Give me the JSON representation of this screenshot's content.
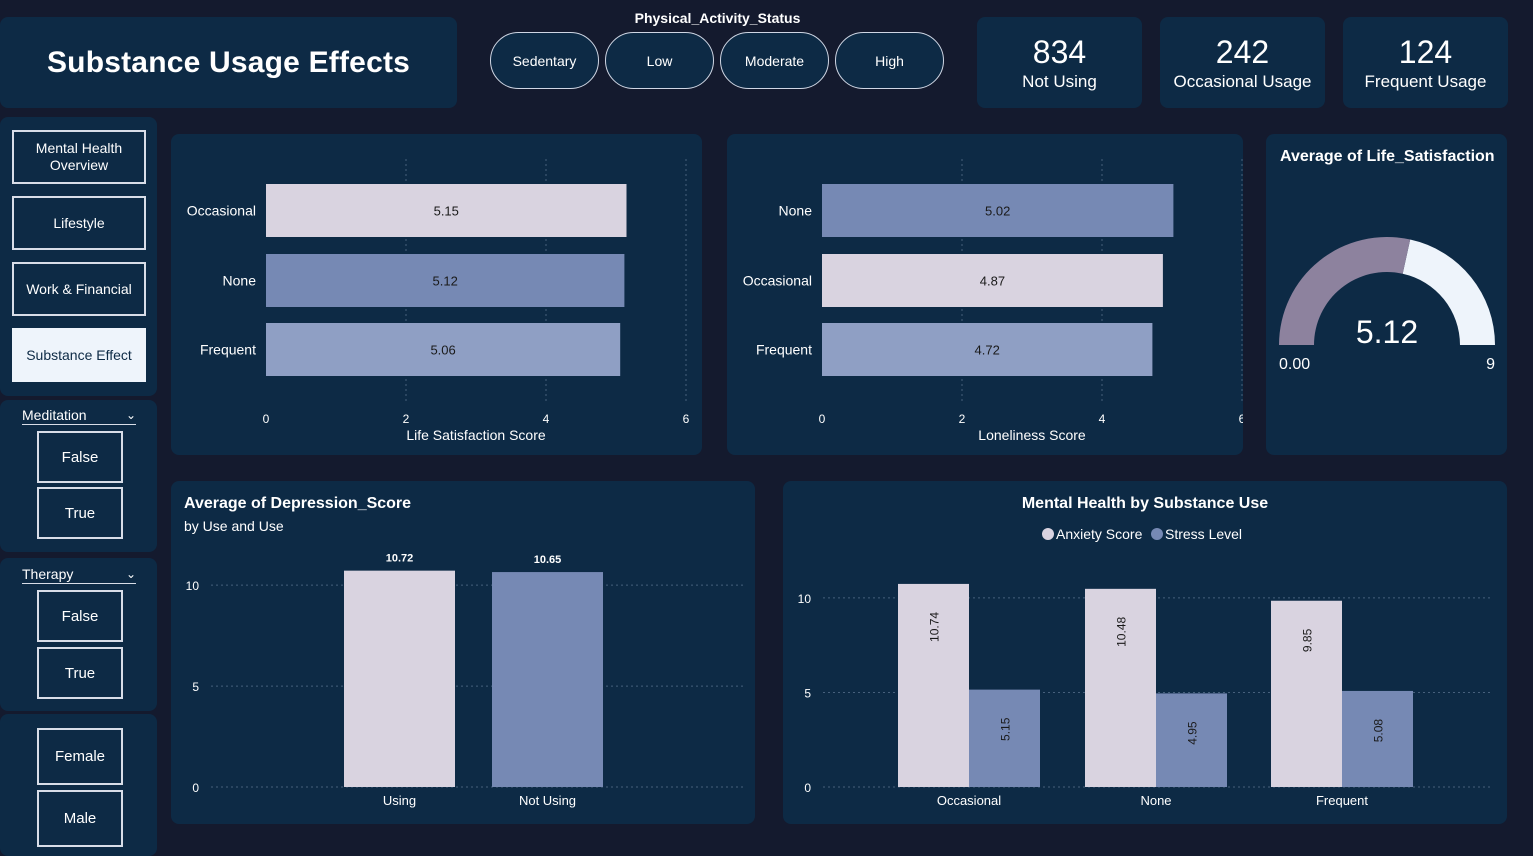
{
  "header": {
    "title": "Substance Usage Effects"
  },
  "physical_activity": {
    "label": "Physical_Activity_Status",
    "options": [
      "Sedentary",
      "Low",
      "Moderate",
      "High"
    ]
  },
  "kpis": [
    {
      "value": "834",
      "label": "Not Using"
    },
    {
      "value": "242",
      "label": "Occasional Usage"
    },
    {
      "value": "124",
      "label": "Frequent Usage"
    }
  ],
  "nav": {
    "items": [
      {
        "label": "Mental Health Overview",
        "active": false
      },
      {
        "label": "Lifestyle",
        "active": false
      },
      {
        "label": "Work & Financial",
        "active": false
      },
      {
        "label": "Substance Effect",
        "active": true
      }
    ]
  },
  "slicers": {
    "meditation": {
      "label": "Meditation",
      "options": [
        "False",
        "True"
      ]
    },
    "therapy": {
      "label": "Therapy",
      "options": [
        "False",
        "True"
      ]
    },
    "gender": {
      "options": [
        "Female",
        "Male"
      ]
    }
  },
  "colors": {
    "background": "#141a2e",
    "panel": "#0d2a45",
    "light_bar": "#d9d3e0",
    "dark_bar": "#7689b4",
    "mid_bar": "#8f9fc4",
    "gauge_fill": "#8d829e",
    "gauge_rest": "#eef4fb"
  },
  "chart_data": [
    {
      "type": "bar",
      "orientation": "horizontal",
      "categories": [
        "Occasional",
        "None",
        "Frequent"
      ],
      "values": [
        5.15,
        5.12,
        5.06
      ],
      "value_labels": [
        "5.15",
        "5.12",
        "5.06"
      ],
      "xlabel": "Life Satisfaction Score",
      "xlim": [
        0,
        6
      ],
      "xticks": [
        "0",
        "2",
        "4",
        "6"
      ]
    },
    {
      "type": "bar",
      "orientation": "horizontal",
      "categories": [
        "None",
        "Occasional",
        "Frequent"
      ],
      "values": [
        5.02,
        4.87,
        4.72
      ],
      "value_labels": [
        "5.02",
        "4.87",
        "4.72"
      ],
      "xlabel": "Loneliness Score",
      "xlim": [
        0,
        6
      ],
      "xticks": [
        "0",
        "2",
        "4",
        "6"
      ]
    },
    {
      "type": "gauge",
      "title": "Average of Life_Satisfaction",
      "value": 5.12,
      "value_label": "5.12",
      "min": 0,
      "max": 9,
      "min_label": "0.00",
      "max_label": "9"
    },
    {
      "type": "bar",
      "title": "Average of Depression_Score",
      "subtitle": "by Use and Use",
      "categories": [
        "Using",
        "Not Using"
      ],
      "values": [
        10.72,
        10.65
      ],
      "value_labels": [
        "10.72",
        "10.65"
      ],
      "ylim": [
        0,
        11
      ],
      "yticks": [
        "0",
        "5",
        "10"
      ]
    },
    {
      "type": "bar",
      "title": "Mental Health by Substance Use",
      "categories": [
        "Occasional",
        "None",
        "Frequent"
      ],
      "series": [
        {
          "name": "Anxiety Score",
          "values": [
            10.74,
            10.48,
            9.85
          ],
          "value_labels": [
            "10.74",
            "10.48",
            "9.85"
          ]
        },
        {
          "name": "Stress Level",
          "values": [
            5.15,
            4.95,
            5.08
          ],
          "value_labels": [
            "5.15",
            "4.95",
            "5.08"
          ]
        }
      ],
      "ylim": [
        0,
        11
      ],
      "yticks": [
        "0",
        "5",
        "10"
      ],
      "legend": "top-center"
    }
  ]
}
